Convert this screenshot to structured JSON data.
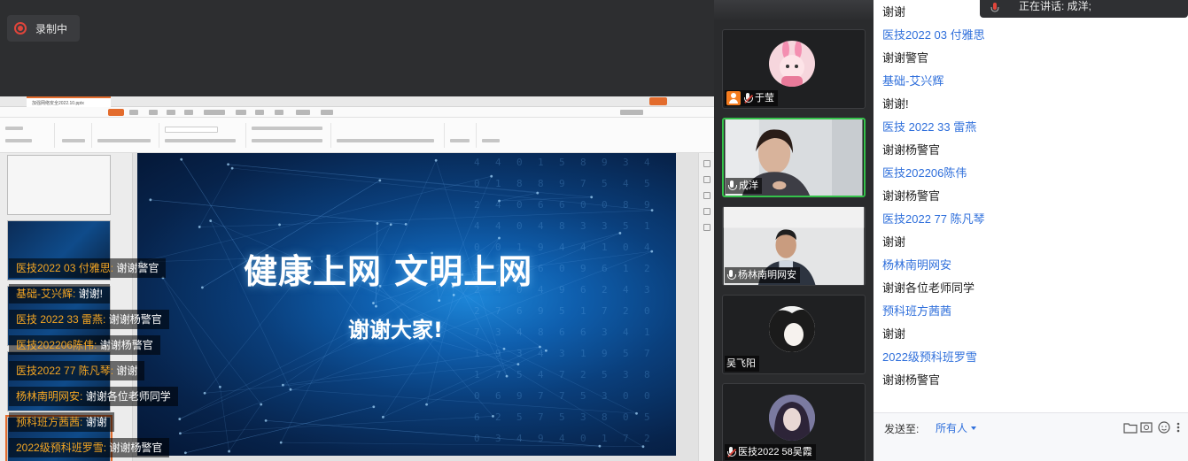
{
  "recording": {
    "label": "录制中"
  },
  "slide": {
    "file_name": "加强网络安全2022.10.pptx",
    "title": "健康上网 文明上网",
    "subtitle": "谢谢大家!"
  },
  "danmaku": [
    {
      "sender": "医技2022 03 付雅思",
      "message": "谢谢警官"
    },
    {
      "sender": "基础-艾兴辉",
      "message": "谢谢!"
    },
    {
      "sender": "医技 2022 33 雷燕",
      "message": "谢谢杨警官"
    },
    {
      "sender": "医技202206陈伟",
      "message": "谢谢杨警官"
    },
    {
      "sender": "医技2022 77 陈凡琴",
      "message": "谢谢"
    },
    {
      "sender": "杨林南明网安",
      "message": "谢谢各位老师同学"
    },
    {
      "sender": "预科班方茜茜",
      "message": "谢谢"
    },
    {
      "sender": "2022级预科班罗雪",
      "message": "谢谢杨警官"
    }
  ],
  "participants": [
    {
      "name": "于莹",
      "mic": "muted",
      "host": true,
      "speaking": false
    },
    {
      "name": "成洋",
      "mic": "on",
      "host": false,
      "speaking": true
    },
    {
      "name": "杨林南明网安",
      "mic": "on",
      "host": false,
      "speaking": false
    },
    {
      "name": "吴飞阳",
      "mic": "none",
      "host": false,
      "speaking": false
    },
    {
      "name": "医技2022 58吴霞",
      "mic": "muted",
      "host": false,
      "speaking": false
    }
  ],
  "chat": {
    "speaking_now": "正在讲话: 成洋;",
    "messages": [
      {
        "type": "msg",
        "text": "谢谢"
      },
      {
        "type": "sender",
        "text": "医技2022 03 付雅思"
      },
      {
        "type": "msg",
        "text": "谢谢警官"
      },
      {
        "type": "sender",
        "text": "基础-艾兴辉"
      },
      {
        "type": "msg",
        "text": "谢谢!"
      },
      {
        "type": "sender",
        "text": "医技 2022 33 雷燕"
      },
      {
        "type": "msg",
        "text": "谢谢杨警官"
      },
      {
        "type": "sender",
        "text": "医技202206陈伟"
      },
      {
        "type": "msg",
        "text": "谢谢杨警官"
      },
      {
        "type": "sender",
        "text": "医技2022 77 陈凡琴"
      },
      {
        "type": "msg",
        "text": "谢谢"
      },
      {
        "type": "sender",
        "text": "杨林南明网安"
      },
      {
        "type": "msg",
        "text": "谢谢各位老师同学"
      },
      {
        "type": "sender",
        "text": "预科班方茜茜"
      },
      {
        "type": "msg",
        "text": "谢谢"
      },
      {
        "type": "sender",
        "text": "2022级预科班罗雪"
      },
      {
        "type": "msg",
        "text": "谢谢杨警官"
      }
    ],
    "send_to_label": "发送至:",
    "send_to_value": "所有人",
    "icons": [
      "folder-icon",
      "screenshot-icon",
      "emoji-icon",
      "more-icon"
    ]
  },
  "colors": {
    "accent": "#2f6fdb",
    "danmaku_sender": "#f5a623",
    "record": "#e0453b",
    "speaking_border": "#35c24b",
    "wps_orange": "#e36c2d"
  }
}
